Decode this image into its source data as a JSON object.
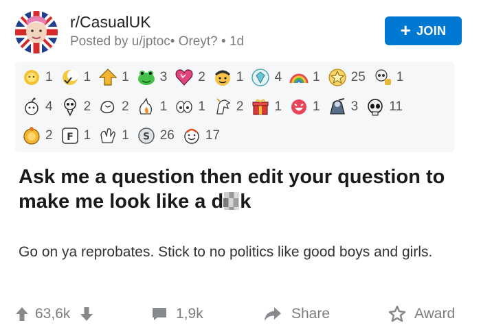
{
  "header": {
    "subreddit": "r/CasualUK",
    "posted_by_prefix": "Posted by ",
    "username": "u/jptoc",
    "flair": "• Oreyt?",
    "separator": "•",
    "age": "1d",
    "join_label": "JOIN",
    "join_icon": "plus-icon",
    "accent_color": "#0079d3"
  },
  "awards": {
    "row1": [
      {
        "icon": "sun-award-icon",
        "count": "1"
      },
      {
        "icon": "crescent-award-icon",
        "count": "1"
      },
      {
        "icon": "up-arrow-award-icon",
        "count": "1"
      },
      {
        "icon": "frog-award-icon",
        "count": "3"
      },
      {
        "icon": "heart-award-icon",
        "count": "2"
      },
      {
        "icon": "face-award-icon",
        "count": "1"
      },
      {
        "icon": "gem-award-icon",
        "count": "4"
      },
      {
        "icon": "rainbow-award-icon",
        "count": "1"
      },
      {
        "icon": "star-award-icon",
        "count": "25"
      },
      {
        "icon": "skull-award-icon",
        "count": "1"
      }
    ],
    "row2": [
      {
        "icon": "snoo-award-icon",
        "count": "4"
      },
      {
        "icon": "skeleton-award-icon",
        "count": "2"
      },
      {
        "icon": "hands-award-icon",
        "count": "2"
      },
      {
        "icon": "fire-award-icon",
        "count": "1"
      },
      {
        "icon": "eyes-award-icon",
        "count": "1"
      },
      {
        "icon": "horse-award-icon",
        "count": "2"
      },
      {
        "icon": "gift-award-icon",
        "count": "1"
      },
      {
        "icon": "laugh-award-icon",
        "count": "1"
      },
      {
        "icon": "wink-award-icon",
        "count": "3"
      },
      {
        "icon": "skull-black-award-icon",
        "count": "11"
      }
    ],
    "row3": [
      {
        "icon": "gold-award-icon",
        "count": "2"
      },
      {
        "icon": "f-key-award-icon",
        "count": "1"
      },
      {
        "icon": "clap-award-icon",
        "count": "1"
      },
      {
        "icon": "silver-award-icon",
        "count": "26"
      },
      {
        "icon": "wholesome-award-icon",
        "count": "17"
      }
    ]
  },
  "post": {
    "title_part1": "Ask me a question then edit your question to make me look like a d",
    "title_part2": "k",
    "body": "Go on ya reprobates. Stick to no politics like good boys and girls."
  },
  "actions": {
    "upvotes": "63,6k",
    "comments": "1,9k",
    "share_label": "Share",
    "award_label": "Award"
  }
}
